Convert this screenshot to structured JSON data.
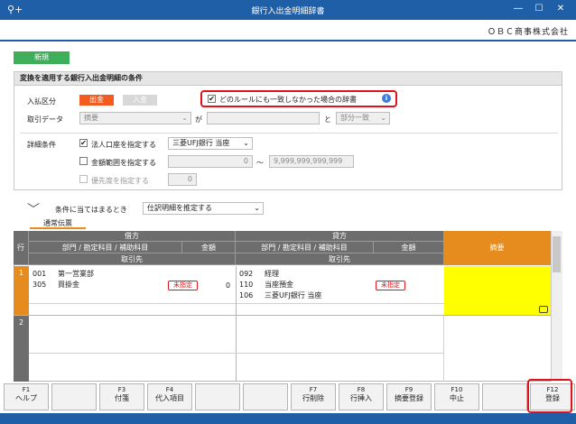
{
  "titlebar": {
    "left_icon": "⚲+",
    "title": "銀行入出金明細辞書",
    "minimize": "―",
    "maximize": "☐",
    "close": "✕"
  },
  "company": "ＯＢＣ商事株式会社",
  "new_tag": "新規",
  "conditions": {
    "heading": "変換を適用する銀行入出金明細の条件",
    "entry_type_label": "入払区分",
    "out_button": "出金",
    "in_button": "入金",
    "no_rule_label": "どのルールにも一致しなかった場合の辞書",
    "trans_data_label": "取引データ",
    "summary_select": "摘要",
    "ga": "が",
    "to": "と",
    "match_select": "部分一致",
    "detail_label": "詳細条件",
    "corp_account_label": "法人口座を指定する",
    "bank_select": "三菱UFJ銀行 当座",
    "amount_label": "金額範囲を指定する",
    "amount_from": "0",
    "tilde": "～",
    "amount_to": "9,999,999,999,999",
    "priority_label": "優先度を指定する",
    "priority_value": "0"
  },
  "matching": {
    "label": "条件に当てはまるとき",
    "select": "仕訳明細を推定する"
  },
  "voucher_tab": "通常伝票",
  "grid": {
    "row_header": "行",
    "debit": "借方",
    "credit": "貸方",
    "dept_account": "部門 / 勘定科目 / 補助科目",
    "amount": "金額",
    "partner": "取引先",
    "summary": "摘要",
    "rows": [
      {
        "num": "1",
        "debit_codes": [
          "001",
          "305"
        ],
        "debit_names": [
          "第一営業部",
          "買掛金"
        ],
        "debit_tag": "未指定",
        "debit_amount": "0",
        "credit_codes": [
          "092",
          "110",
          "106"
        ],
        "credit_names": [
          "経理",
          "当座預金",
          "三菱UFJ銀行 当座"
        ],
        "credit_tag": "未指定"
      },
      {
        "num": "2"
      }
    ]
  },
  "fkeys": [
    {
      "key": "F1",
      "label": "ヘルプ"
    },
    {
      "key": "",
      "label": ""
    },
    {
      "key": "F3",
      "label": "付箋"
    },
    {
      "key": "F4",
      "label": "代入項目"
    },
    {
      "key": "",
      "label": ""
    },
    {
      "key": "",
      "label": ""
    },
    {
      "key": "F7",
      "label": "行削除"
    },
    {
      "key": "F8",
      "label": "行挿入"
    },
    {
      "key": "F9",
      "label": "摘要登録"
    },
    {
      "key": "F10",
      "label": "中止"
    },
    {
      "key": "",
      "label": ""
    },
    {
      "key": "F12",
      "label": "登録"
    }
  ]
}
